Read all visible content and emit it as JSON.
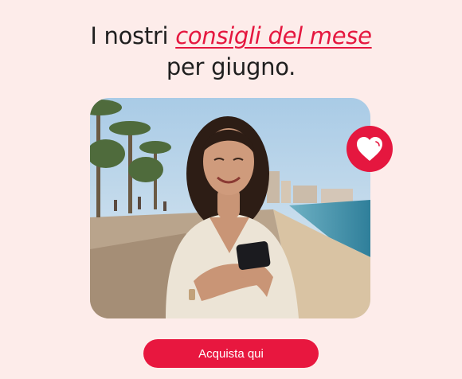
{
  "headline": {
    "line1_prefix": "I nostri ",
    "line1_accent": "consigli del mese",
    "line2": "per giugno."
  },
  "cta": {
    "label": "Acquista qui"
  },
  "icons": {
    "badge": "heart-icon"
  },
  "colors": {
    "background": "#fdecea",
    "accent": "#e5173f",
    "button": "#e8173f",
    "text": "#1f1f1f"
  }
}
